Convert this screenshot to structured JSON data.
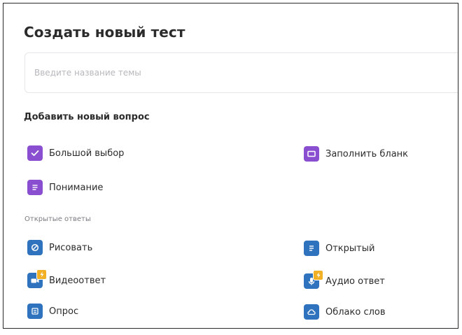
{
  "header": {
    "title": "Создать новый тест"
  },
  "topic_input": {
    "value": "",
    "placeholder": "Введите название темы"
  },
  "add_question": {
    "title": "Добавить новый вопрос",
    "items": [
      {
        "label": "Большой выбор",
        "icon": "checkbox-icon",
        "color": "#8a4fd0"
      },
      {
        "label": "Заполнить бланк",
        "icon": "blank-field-icon",
        "color": "#8a4fd0"
      },
      {
        "label": "Понимание",
        "icon": "document-lines-icon",
        "color": "#8a4fd0"
      }
    ]
  },
  "open_answers": {
    "title": "Открытые ответы",
    "items": [
      {
        "label": "Рисовать",
        "icon": "draw-icon",
        "color": "#2f72bd"
      },
      {
        "label": "Открытый",
        "icon": "text-lines-icon",
        "color": "#2f72bd"
      },
      {
        "label": "Видеоответ",
        "icon": "video-camera-icon",
        "color": "#2f72bd",
        "badge": "lightning-badge-icon",
        "badge_color": "#f2b024"
      },
      {
        "label": "Аудио ответ",
        "icon": "microphone-icon",
        "color": "#2f72bd",
        "badge": "lightning-badge-icon",
        "badge_color": "#f2b024"
      },
      {
        "label": "Опрос",
        "icon": "poll-icon",
        "color": "#2f72bd"
      },
      {
        "label": "Облако слов",
        "icon": "cloud-icon",
        "color": "#2f72bd"
      }
    ]
  }
}
